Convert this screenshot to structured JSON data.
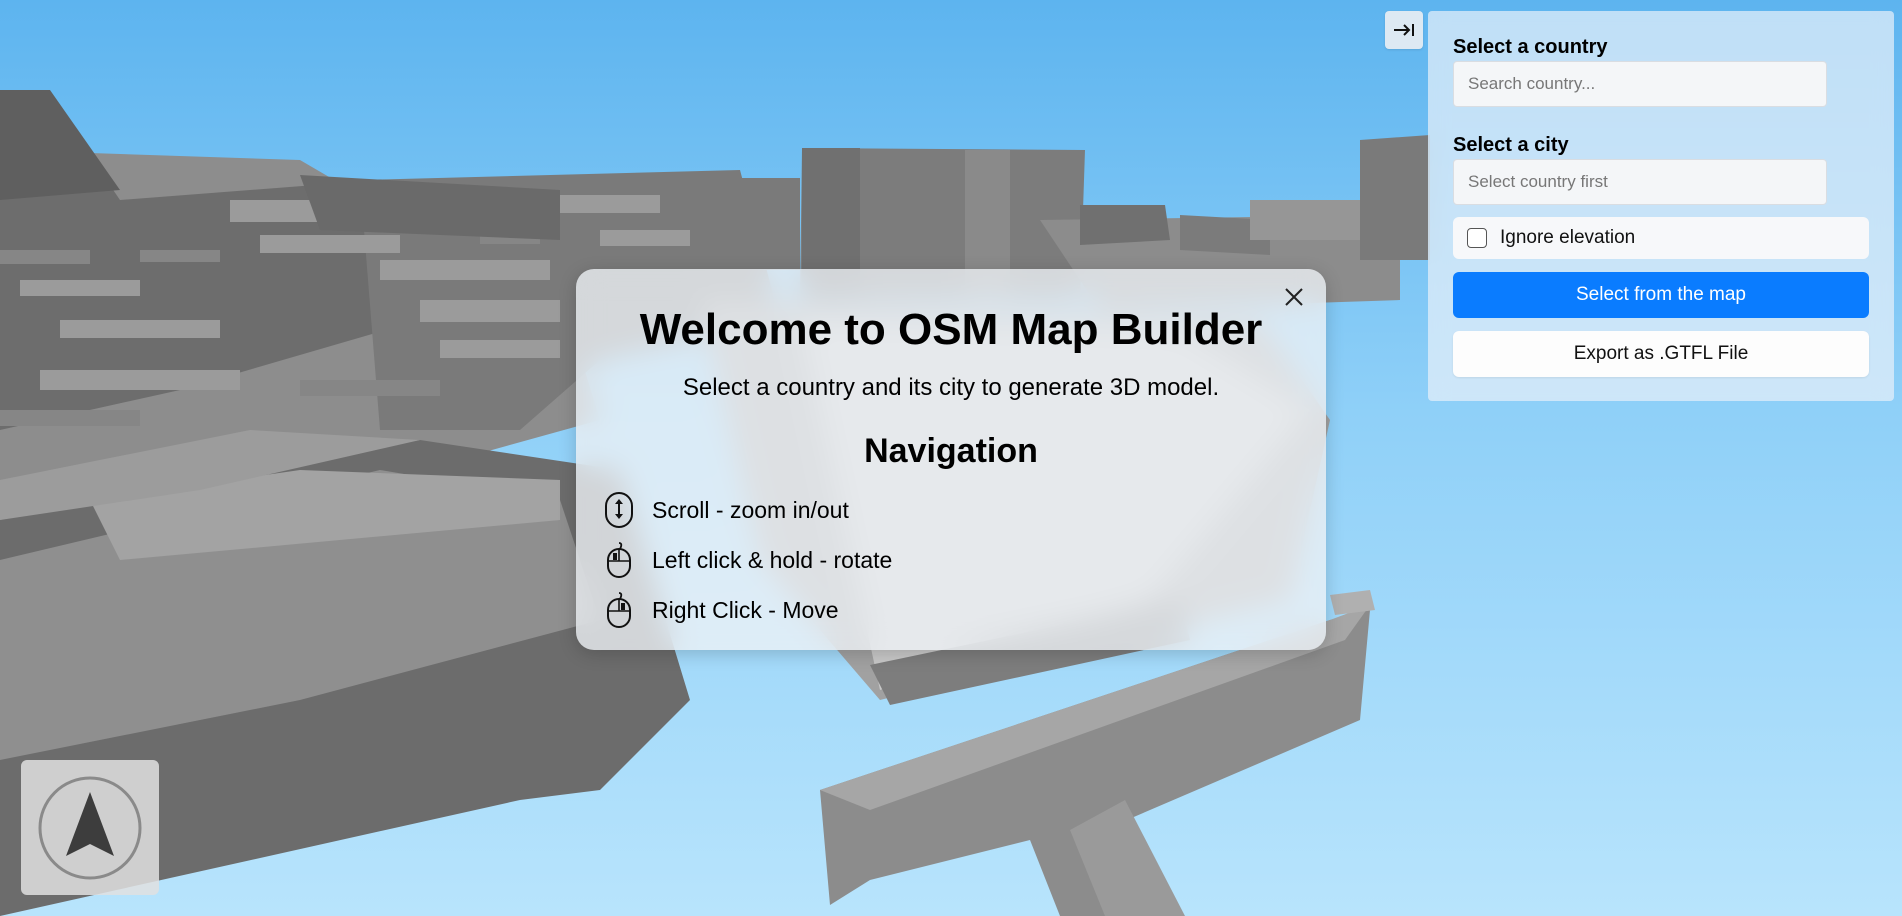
{
  "modal": {
    "title": "Welcome to OSM Map Builder",
    "subtitle": "Select a country and its city to generate 3D model.",
    "navigation_title": "Navigation",
    "items": [
      {
        "icon": "mouse-scroll-icon",
        "label": "Scroll - zoom in/out"
      },
      {
        "icon": "mouse-left-click-icon",
        "label": "Left click & hold - rotate"
      },
      {
        "icon": "mouse-right-click-icon",
        "label": "Right Click - Move"
      }
    ],
    "close_icon": "close-icon"
  },
  "panel": {
    "collapse_icon": "collapse-panel-icon",
    "country_label": "Select a country",
    "country_placeholder": "Search country...",
    "city_label": "Select a city",
    "city_placeholder": "Select country first",
    "ignore_elevation_label": "Ignore elevation",
    "ignore_elevation_checked": false,
    "select_map_button": "Select from the map",
    "export_button": "Export as .GTFL File"
  },
  "compass": {
    "icon": "compass-arrow-icon"
  },
  "colors": {
    "sky_top": "#5db4ef",
    "sky_bottom": "#b8e4fc",
    "accent": "#0a7cff",
    "building_dark": "#6b6b6b",
    "building_light": "#9a9a9a"
  }
}
